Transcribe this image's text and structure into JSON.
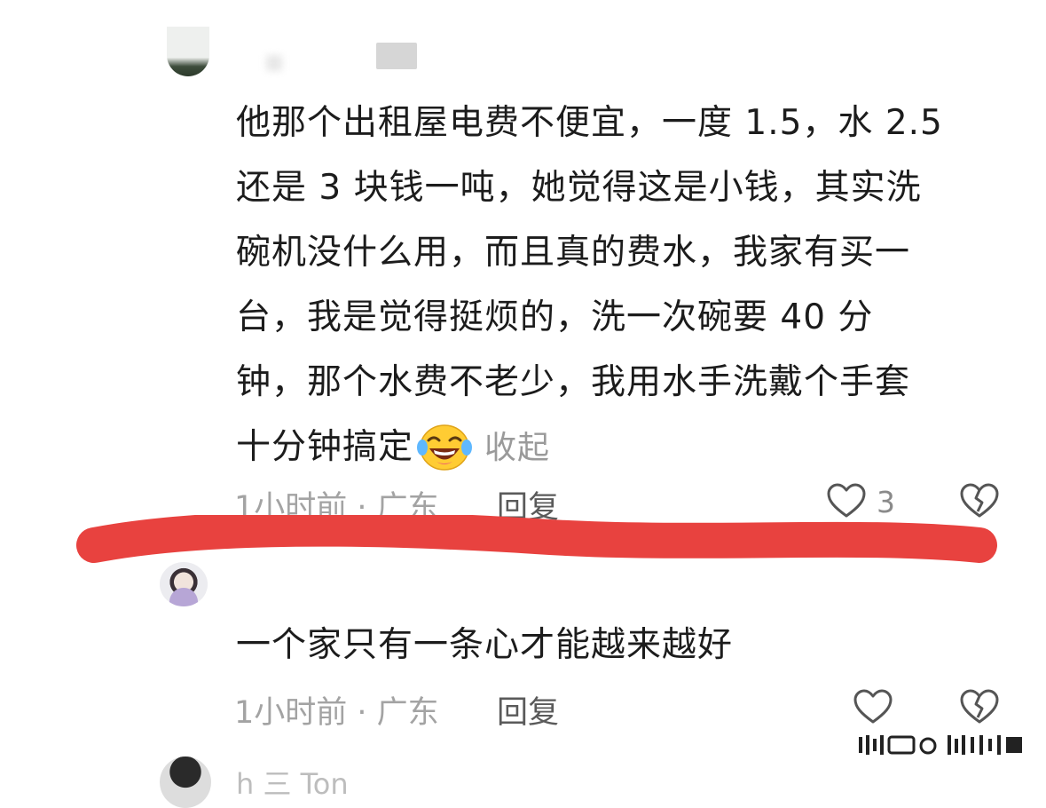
{
  "comment_1": {
    "lines": [
      "他那个出租屋电费不便宜，一度 1.5，水 2.5",
      "还是 3 块钱一吨，她觉得这是小钱，其实洗",
      "碗机没什么用，而且真的费水，我家有买一",
      "台，我是觉得挺烦的，洗一次碗要 40 分",
      "钟，那个水费不老少，我用水手洗戴个手套",
      "十分钟搞定"
    ],
    "emoji": "laughing-with-tears",
    "collapse_label": "收起",
    "meta": "1小时前 · 广东",
    "reply_label": "回复",
    "like_count": "3"
  },
  "comment_2": {
    "text": "一个家只有一条心才能越来越好",
    "meta": "1小时前 · 广东",
    "reply_label": "回复"
  },
  "comment_3": {
    "name_partial": "h 三 Ton"
  },
  "colors": {
    "red_stroke": "#e8423f",
    "meta_text": "#a3a3a3"
  }
}
